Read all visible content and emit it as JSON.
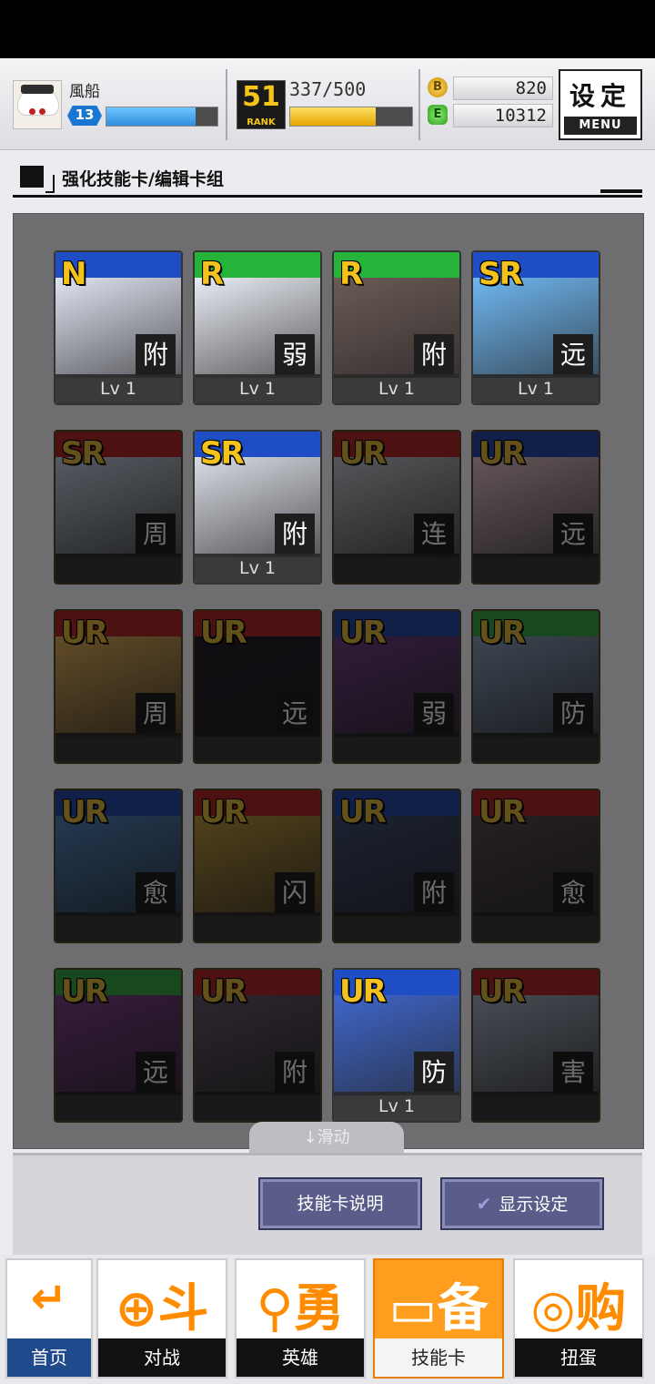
{
  "player": {
    "name": "風船",
    "level": "13",
    "exp_fraction": 0.8
  },
  "rank": {
    "value": "51",
    "label": "RANK",
    "progress_text": "337/500",
    "progress_fraction": 0.7
  },
  "currency": {
    "coin_icon": "B",
    "coins": "820",
    "gem_icon": "E",
    "gems": "10312"
  },
  "menu": {
    "big_label": "设定",
    "small_label": "MENU"
  },
  "page": {
    "title": "强化技能卡/编辑卡组"
  },
  "cards": [
    {
      "rarity": "N",
      "type": "附",
      "level": "Lv 1",
      "locked": false,
      "band": "#1f4dc4",
      "art": "#dfe3f0"
    },
    {
      "rarity": "R",
      "type": "弱",
      "level": "Lv 1",
      "locked": false,
      "band": "#26b33a",
      "art": "#e9ecf4"
    },
    {
      "rarity": "R",
      "type": "附",
      "level": "Lv 1",
      "locked": false,
      "band": "#26b33a",
      "art": "#6a5a55"
    },
    {
      "rarity": "SR",
      "type": "远",
      "level": "Lv 1",
      "locked": false,
      "band": "#1f4dc4",
      "art": "#6fb6f0"
    },
    {
      "rarity": "SR",
      "type": "周",
      "level": "",
      "locked": true,
      "band": "#d42020",
      "art": "#c9d6ea"
    },
    {
      "rarity": "SR",
      "type": "附",
      "level": "Lv 1",
      "locked": false,
      "band": "#1f4dc4",
      "art": "#d9dce4"
    },
    {
      "rarity": "UR",
      "type": "连",
      "level": "",
      "locked": true,
      "band": "#d42020",
      "art": "#c9ccd4"
    },
    {
      "rarity": "UR",
      "type": "远",
      "level": "",
      "locked": true,
      "band": "#1f4dc4",
      "art": "#f1c8cf"
    },
    {
      "rarity": "UR",
      "type": "周",
      "level": "",
      "locked": true,
      "band": "#d42020",
      "art": "#f2b247"
    },
    {
      "rarity": "UR",
      "type": "远",
      "level": "",
      "locked": true,
      "band": "#d42020",
      "art": "#2b2030"
    },
    {
      "rarity": "UR",
      "type": "弱",
      "level": "",
      "locked": true,
      "band": "#1f4dc4",
      "art": "#7a3f95"
    },
    {
      "rarity": "UR",
      "type": "防",
      "level": "",
      "locked": true,
      "band": "#26b33a",
      "art": "#8aa4c8"
    },
    {
      "rarity": "UR",
      "type": "愈",
      "level": "",
      "locked": true,
      "band": "#1f4dc4",
      "art": "#4b88d0"
    },
    {
      "rarity": "UR",
      "type": "闪",
      "level": "",
      "locked": true,
      "band": "#d42020",
      "art": "#c89a2a"
    },
    {
      "rarity": "UR",
      "type": "附",
      "level": "",
      "locked": true,
      "band": "#1f4dc4",
      "art": "#40507e"
    },
    {
      "rarity": "UR",
      "type": "愈",
      "level": "",
      "locked": true,
      "band": "#d42020",
      "art": "#5b4b55"
    },
    {
      "rarity": "UR",
      "type": "远",
      "level": "",
      "locked": true,
      "band": "#26b33a",
      "art": "#8a3f9a"
    },
    {
      "rarity": "UR",
      "type": "附",
      "level": "",
      "locked": true,
      "band": "#d42020",
      "art": "#6a5a70"
    },
    {
      "rarity": "UR",
      "type": "防",
      "level": "Lv 1",
      "locked": false,
      "band": "#1f4dc4",
      "art": "#3e65c8"
    },
    {
      "rarity": "UR",
      "type": "害",
      "level": "",
      "locked": true,
      "band": "#d42020",
      "art": "#a8b4cc"
    }
  ],
  "scroll_hint": "↓滑动",
  "buttons": {
    "card_info": "技能卡说明",
    "display_settings": "显示设定",
    "check_icon": "✔"
  },
  "nav": {
    "home": {
      "glyph": "↵",
      "label": "首页"
    },
    "battle": {
      "glyph": "⊕斗",
      "label": "对战"
    },
    "hero": {
      "glyph": "⚲勇",
      "label": "英雄"
    },
    "cards": {
      "glyph": "▭备",
      "label": "技能卡"
    },
    "gacha": {
      "glyph": "◎购",
      "label": "扭蛋"
    }
  }
}
